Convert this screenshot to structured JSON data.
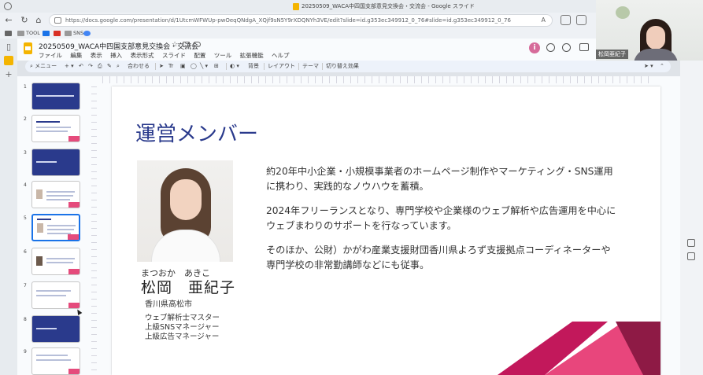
{
  "window": {
    "title": "20250509_WACA中四国支部意見交換会・交流会 - Google スライド"
  },
  "browser": {
    "url": "https://docs.google.com/presentation/d/1UtcmWFWUp-pwOeqQNdgA_XQjf9sN5Y9rXDQNYh3VE/edit?slide=id.g353ec349912_0_76#slide=id.g353ec349912_0_76",
    "zoom_icon": "A",
    "bookmarks": [
      "TOOL",
      "SNS"
    ]
  },
  "app": {
    "doc_title": "20250509_WACA中四国支部意見交換会・交流会",
    "menu": [
      "ファイル",
      "編集",
      "表示",
      "挿入",
      "表示形式",
      "スライド",
      "配置",
      "ツール",
      "拡張機能",
      "ヘルプ"
    ],
    "slideshow_label": "ス",
    "gemini_label": "i"
  },
  "toolbar": {
    "menu_label": "メニュー",
    "zoom_label": "合わせる",
    "background_label": "背景",
    "layout_label": "レイアウト",
    "theme_label": "テーマ",
    "transition_label": "切り替え効果"
  },
  "filmstrip": {
    "slides": [
      {
        "num": "1",
        "style": "dark"
      },
      {
        "num": "2",
        "style": "light"
      },
      {
        "num": "3",
        "style": "dark"
      },
      {
        "num": "4",
        "style": "light"
      },
      {
        "num": "5",
        "style": "light",
        "selected": true
      },
      {
        "num": "6",
        "style": "light"
      },
      {
        "num": "7",
        "style": "light"
      },
      {
        "num": "8",
        "style": "dark"
      },
      {
        "num": "9",
        "style": "light"
      }
    ]
  },
  "slide": {
    "title": "運営メンバー",
    "furigana": "まつおか　あきこ",
    "name": "松岡　亜紀子",
    "location": "香川県高松市",
    "qualifications": [
      "ウェブ解析士マスター",
      "上級SNSマネージャー",
      "上級広告マネージャー"
    ],
    "bio": [
      "約20年中小企業・小規模事業者のホームページ制作やマーケティング・SNS運用に携わり、実践的なノウハウを蓄積。",
      "2024年フリーランスとなり、専門学校や企業様のウェブ解析や広告運用を中心にウェブまわりのサポートを行なっています。",
      "そのほか、公財）かがわ産業支援財団香川県よろず支援拠点コーディネーターや専門学校の非常勤講師などにも従事。"
    ],
    "accent_colors": [
      "#e8467c",
      "#c2185b",
      "#8e1a45"
    ]
  },
  "webcam": {
    "participant_name": "松岡亜紀子"
  }
}
